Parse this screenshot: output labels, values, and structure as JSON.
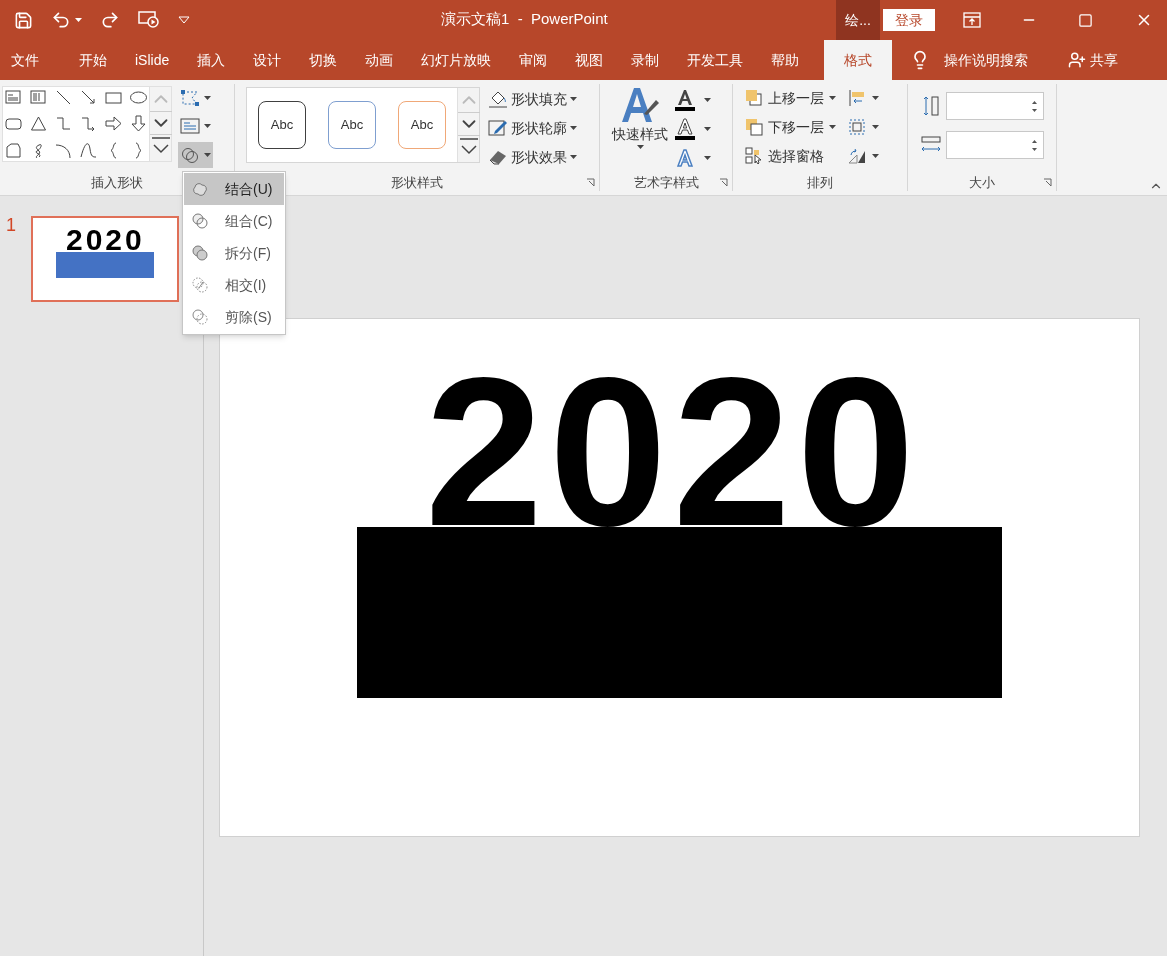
{
  "title_bar": {
    "title": "演示文稿1  -  PowerPoint",
    "context_tab": "绘...",
    "login": "登录"
  },
  "tabs": [
    {
      "label": "文件",
      "selected": false
    },
    {
      "label": "开始",
      "selected": false
    },
    {
      "label": "iSlide",
      "selected": false
    },
    {
      "label": "插入",
      "selected": false
    },
    {
      "label": "设计",
      "selected": false
    },
    {
      "label": "切换",
      "selected": false
    },
    {
      "label": "动画",
      "selected": false
    },
    {
      "label": "幻灯片放映",
      "selected": false
    },
    {
      "label": "审阅",
      "selected": false
    },
    {
      "label": "视图",
      "selected": false
    },
    {
      "label": "录制",
      "selected": false
    },
    {
      "label": "开发工具",
      "selected": false
    },
    {
      "label": "帮助",
      "selected": false
    },
    {
      "label": "格式",
      "selected": true
    }
  ],
  "tell_me": "操作说明搜索",
  "share": "共享",
  "groups": {
    "insert_shapes": "插入形状",
    "shape_styles": "形状样式",
    "wordart_styles": "艺术字样式",
    "arrange": "排列",
    "size": "大小"
  },
  "style_gallery": [
    {
      "text": "Abc",
      "color": "#404040"
    },
    {
      "text": "Abc",
      "color": "#7f9fd0"
    },
    {
      "text": "Abc",
      "color": "#f0a878"
    }
  ],
  "shape_style_buttons": [
    "形状填充",
    "形状轮廓",
    "形状效果"
  ],
  "quick_styles": "快速样式",
  "arrange_buttons": [
    "上移一层",
    "下移一层",
    "选择窗格"
  ],
  "merge_menu": [
    {
      "label": "结合(U)",
      "selected": true
    },
    {
      "label": "组合(C)",
      "selected": false
    },
    {
      "label": "拆分(F)",
      "selected": false
    },
    {
      "label": "相交(I)",
      "selected": false
    },
    {
      "label": "剪除(S)",
      "selected": false
    }
  ],
  "thumbnails": [
    {
      "number": "1",
      "selected": true,
      "text": "2020"
    }
  ],
  "slide": {
    "text": "2020"
  }
}
